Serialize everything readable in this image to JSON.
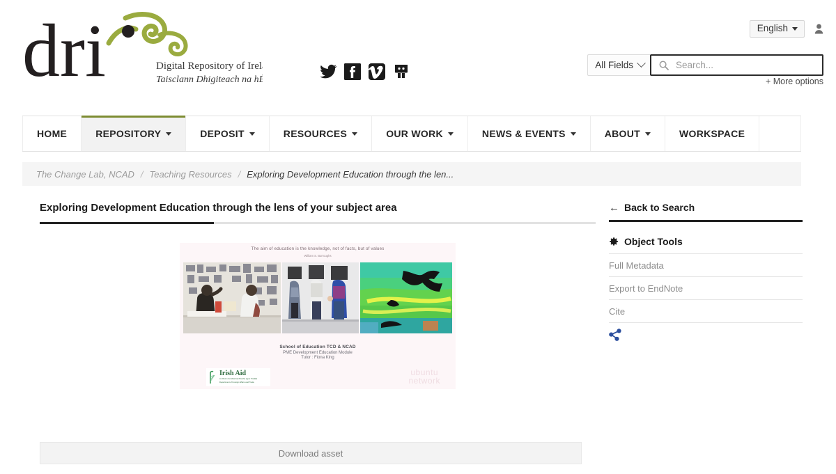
{
  "header": {
    "logo": {
      "wordmark": "dri",
      "line1": "Digital Repository of Ireland",
      "line2": "Taisclann Dhigiteach na hÉireann"
    },
    "social": [
      {
        "name": "twitter-icon",
        "label": "Twitter"
      },
      {
        "name": "facebook-icon",
        "label": "Facebook"
      },
      {
        "name": "vimeo-icon",
        "label": "Vimeo"
      },
      {
        "name": "slideshare-icon",
        "label": "SlideShare"
      }
    ],
    "language": "English",
    "account_icon": "user-icon",
    "search": {
      "field_scope": "All Fields",
      "placeholder": "Search...",
      "value": "",
      "more_options": "+ More options"
    }
  },
  "nav": {
    "items": [
      {
        "label": "HOME",
        "caret": false,
        "active": false
      },
      {
        "label": "REPOSITORY",
        "caret": true,
        "active": true
      },
      {
        "label": "DEPOSIT",
        "caret": true,
        "active": false
      },
      {
        "label": "RESOURCES",
        "caret": true,
        "active": false
      },
      {
        "label": "OUR WORK",
        "caret": true,
        "active": false
      },
      {
        "label": "NEWS & EVENTS",
        "caret": true,
        "active": false
      },
      {
        "label": "ABOUT",
        "caret": true,
        "active": false
      },
      {
        "label": "WORKSPACE",
        "caret": false,
        "active": false
      }
    ],
    "active_accent": "#7d8c32"
  },
  "breadcrumb": {
    "items": [
      "The Change Lab, NCAD",
      "Teaching Resources",
      "Exploring Development Education through the len..."
    ],
    "separator": "/"
  },
  "main": {
    "title": "Exploring Development Education through the lens of your subject area",
    "download_label": "Download asset",
    "slide": {
      "quote": "The aim of education is the knowledge, not of facts, but of values",
      "attribution": "William S. Burroughs",
      "credit_line1": "School of Education TCD & NCAD",
      "credit_line2": "PME Development Education Module",
      "credit_line3": "Tutor : Fiona King",
      "logo_irish_aid": "Irish Aid",
      "logo_irish_aid_sub1": "An Roinn Gnóthaí Eachtracha agus Trádála",
      "logo_irish_aid_sub2": "Department of Foreign Affairs and Trade",
      "logo_ubuntu_line1": "ubuntu",
      "logo_ubuntu_line2": "network"
    }
  },
  "sidebar": {
    "back_to_search": "Back to Search",
    "back_arrow": "←",
    "object_tools_label": "Object Tools",
    "tools": [
      "Full Metadata",
      "Export to EndNote",
      "Cite"
    ],
    "share_icon": "share-icon",
    "share_color": "#2c4f9e"
  }
}
